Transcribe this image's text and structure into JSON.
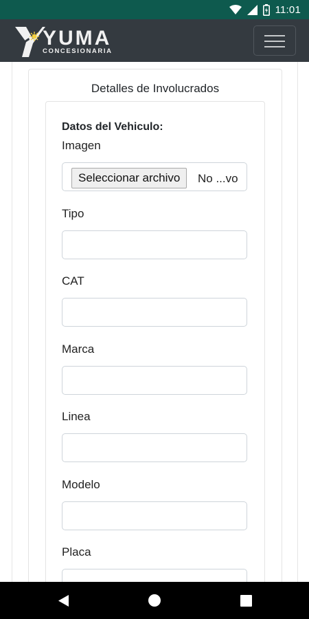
{
  "status_bar": {
    "time": "11:01",
    "icons": [
      "wifi-icon",
      "signal-icon",
      "battery-icon"
    ]
  },
  "navbar": {
    "brand": "YUMA",
    "brand_sub": "CONCESIONARIA",
    "menu_icon": "hamburger-icon"
  },
  "card": {
    "title": "Detalles de Involucrados",
    "section_title": "Datos del Vehiculo:",
    "imagen": {
      "label": "Imagen",
      "button_label": "Seleccionar archivo",
      "file_status": "No ...vo"
    },
    "fields": [
      {
        "label": "Tipo",
        "value": ""
      },
      {
        "label": "CAT",
        "value": ""
      },
      {
        "label": "Marca",
        "value": ""
      },
      {
        "label": "Linea",
        "value": ""
      },
      {
        "label": "Modelo",
        "value": ""
      },
      {
        "label": "Placa",
        "value": ""
      }
    ]
  },
  "system_nav": {
    "icons": [
      "back-icon",
      "home-icon",
      "recents-icon"
    ]
  },
  "colors": {
    "status_bar": "#0e5a4e",
    "navbar": "#343a40"
  }
}
